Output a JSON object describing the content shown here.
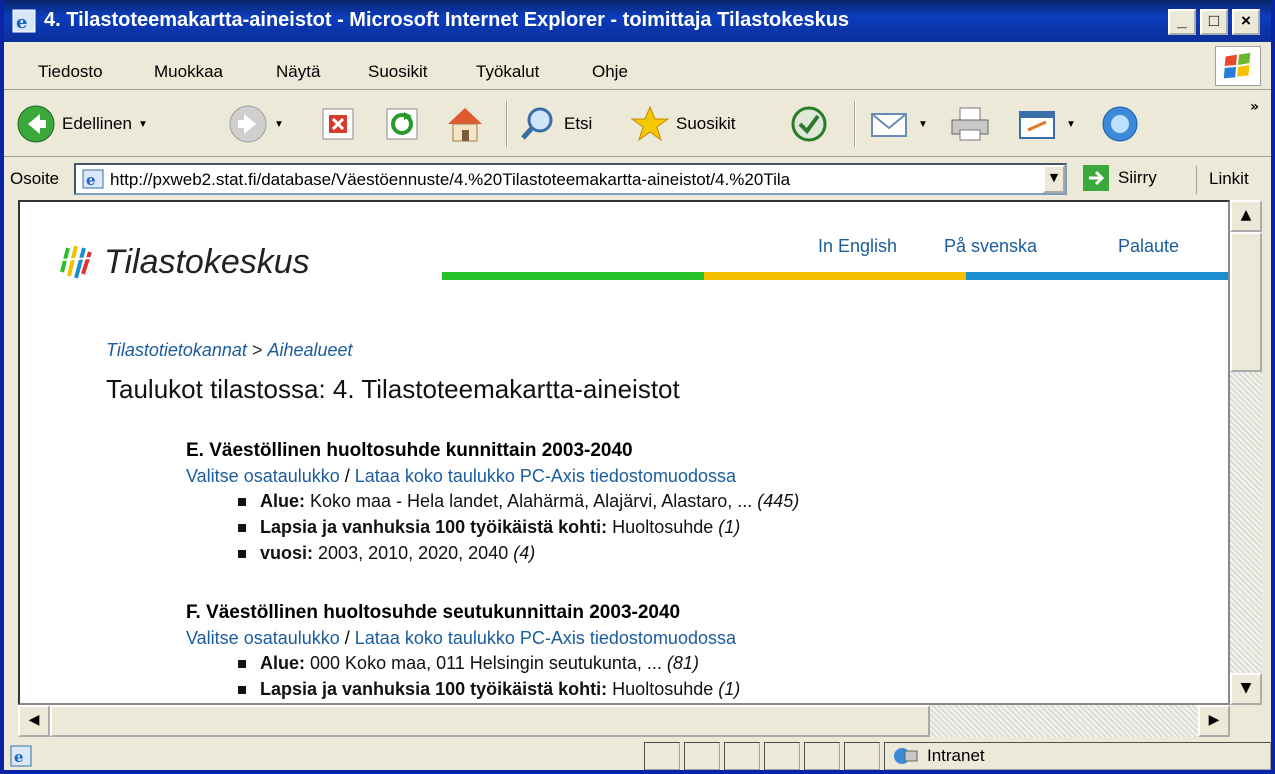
{
  "window": {
    "title": "4. Tilastoteemakartta-aineistot - Microsoft Internet Explorer - toimittaja Tilastokeskus"
  },
  "menu": [
    {
      "label": "Tiedosto",
      "key": "T"
    },
    {
      "label": "Muokkaa",
      "key": "M"
    },
    {
      "label": "Näytä",
      "key": "N"
    },
    {
      "label": "Suosikit",
      "key": "S"
    },
    {
      "label": "Työkalut",
      "key": "k"
    },
    {
      "label": "Ohje",
      "key": "O"
    }
  ],
  "toolbar": {
    "back": "Edellinen",
    "search": "Etsi",
    "favorites": "Suosikit"
  },
  "address": {
    "label": "Osoite",
    "url": "http://pxweb2.stat.fi/database/Väestöennuste/4.%20Tilastoteemakartta-aineistot/4.%20Tila",
    "go": "Siirry",
    "links": "Linkit"
  },
  "status": {
    "zone": "Intranet"
  },
  "page": {
    "logo": "Tilastokeskus",
    "toplinks": [
      "In English",
      "På svenska",
      "Palaute"
    ],
    "breadcrumb": {
      "db": "Tilastotietokannat",
      "sep": " > ",
      "area": "Aihealueet"
    },
    "title": "Taulukot tilastossa: 4. Tilastoteemakartta-aineistot",
    "tables": [
      {
        "name": "E. Väestöllinen huoltosuhde kunnittain 2003-2040",
        "select": "Valitse osataulukko",
        "slash": " / ",
        "download": "Lataa koko taulukko PC-Axis tiedostomuodossa",
        "vars": [
          {
            "label": "Alue:",
            "values": "Koko maa - Hela landet, Alahärmä, Alajärvi, Alastaro, ...",
            "count": "(445)"
          },
          {
            "label": "Lapsia ja vanhuksia 100 työikäistä kohti:",
            "values": "Huoltosuhde",
            "count": "(1)"
          },
          {
            "label": "vuosi:",
            "values": "2003, 2010, 2020, 2040",
            "count": "(4)"
          }
        ]
      },
      {
        "name": "F. Väestöllinen huoltosuhde seutukunnittain 2003-2040",
        "select": "Valitse osataulukko",
        "slash": " / ",
        "download": "Lataa koko taulukko PC-Axis tiedostomuodossa",
        "vars": [
          {
            "label": "Alue:",
            "values": "000 Koko maa, 011 Helsingin seutukunta, ...",
            "count": "(81)"
          },
          {
            "label": "Lapsia ja vanhuksia 100 työikäistä kohti:",
            "values": "Huoltosuhde",
            "count": "(1)"
          }
        ]
      }
    ]
  },
  "colors": {
    "link": "#1a5c9e",
    "bar_green": "#27c12a",
    "bar_yellow": "#f5c000",
    "bar_blue": "#1a8fd0",
    "titlebar": "#0a3cb8"
  }
}
